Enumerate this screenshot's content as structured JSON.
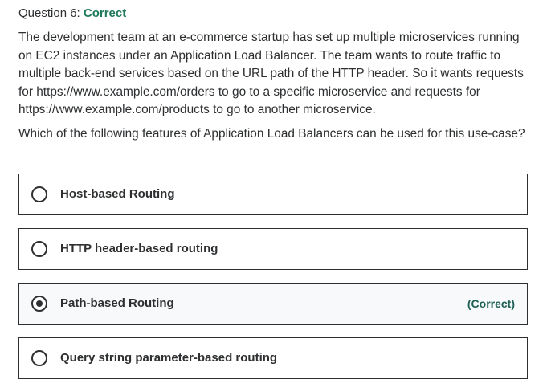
{
  "question": {
    "label": "Question 6:",
    "status": "Correct",
    "status_color": "#1e7a5a",
    "prompt": "The development team at an e-commerce startup has set up multiple microservices running on EC2 instances under an Application Load Balancer. The team wants to route traffic to multiple back-end services based on the URL path of the HTTP header. So it wants requests for https://www.example.com/orders to go to a specific microservice and requests for https://www.example.com/products to go to another microservice.",
    "ask": "Which of the following features of Application Load Balancers can be used for this use-case?"
  },
  "answers": [
    {
      "label": "Host-based Routing",
      "selected": false,
      "tag": ""
    },
    {
      "label": "HTTP header-based routing",
      "selected": false,
      "tag": ""
    },
    {
      "label": "Path-based Routing",
      "selected": true,
      "tag": "(Correct)"
    },
    {
      "label": "Query string parameter-based routing",
      "selected": false,
      "tag": ""
    }
  ],
  "colors": {
    "text": "#2d2f31",
    "correct_green": "#1e7a5a",
    "correct_tag": "#1e6055",
    "correct_bg": "#f7f9fa"
  }
}
